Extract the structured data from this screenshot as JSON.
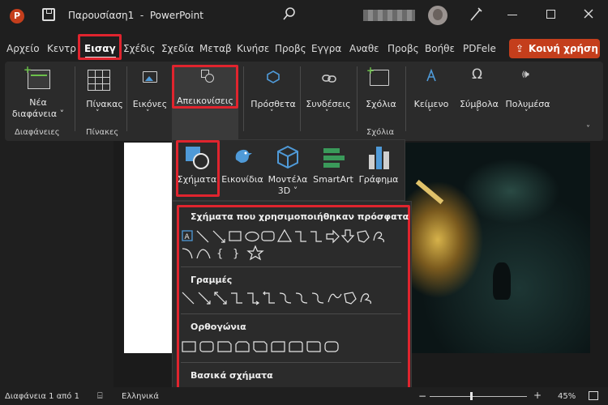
{
  "titlebar": {
    "doc_title": "Παρουσίαση1  -  PowerPoint"
  },
  "tabs": [
    "Αρχείο",
    "Κεντρ",
    "Εισαγ",
    "Σχέδις",
    "Σχεδία",
    "Μεταβ",
    "Κινήσε",
    "Προβς",
    "Εγγρα",
    "Αναθε",
    "Προβς",
    "Βοήθε",
    "PDFele"
  ],
  "share_label": "Κοινή χρήση",
  "ribbon": {
    "new_slide": {
      "line1": "Νέα",
      "line2": "διαφάνεια ˅",
      "group": "Διαφάνειες"
    },
    "table": {
      "label": "Πίνακας",
      "group": "Πίνακες"
    },
    "images": {
      "label": "Εικόνες"
    },
    "illustrations": {
      "label": "Απεικονίσεις"
    },
    "addins": {
      "label": "Πρόσθετα"
    },
    "links": {
      "label": "Συνδέσεις"
    },
    "comments": {
      "label": "Σχόλια",
      "group": "Σχόλια"
    },
    "text": {
      "label": "Κείμενο"
    },
    "symbols": {
      "label": "Σύμβολα"
    },
    "media": {
      "label": "Πολυμέσα"
    }
  },
  "illus_menu": {
    "shapes": "Σχήματα",
    "icons": "Εικονίδια",
    "models_line1": "Μοντέλα",
    "models_line2": "3D ˅",
    "smartart": "SmartArt",
    "chart": "Γράφημα"
  },
  "gallery": {
    "recent": "Σχήματα που χρησιμοποιήθηκαν πρόσφατα",
    "lines": "Γραμμές",
    "rectangles": "Ορθογώνια",
    "basic": "Βασικά σχήματα"
  },
  "status": {
    "slide": "Διαφάνεια 1 από 1",
    "language": "Ελληνικά",
    "zoom": "45%"
  },
  "colors": {
    "accent_red": "#e0242e",
    "share": "#c43e1c",
    "app_icon": "#c43e1c"
  }
}
